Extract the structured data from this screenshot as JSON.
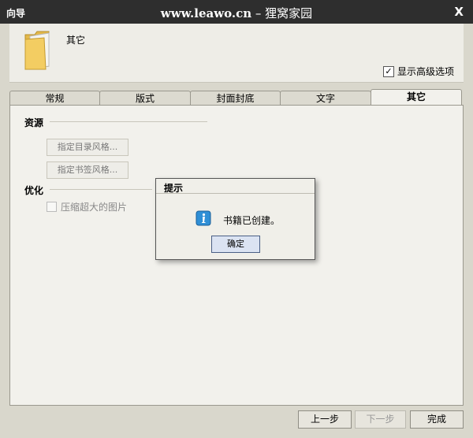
{
  "window": {
    "app_label": "向导",
    "site": "www.leawo.cn",
    "separator": " – ",
    "site_name": "狸窝家园",
    "close_glyph": "X"
  },
  "header": {
    "title": "其它",
    "advanced_label": "显示高级选项",
    "advanced_checked": true
  },
  "tabs": [
    {
      "label": "常规",
      "active": false
    },
    {
      "label": "版式",
      "active": false
    },
    {
      "label": "封面封底",
      "active": false
    },
    {
      "label": "文字",
      "active": false
    },
    {
      "label": "其它",
      "active": true
    }
  ],
  "content": {
    "resources_label": "资源",
    "toc_style_button": "指定目录风格...",
    "bookmark_style_button": "指定书签风格...",
    "optimize_label": "优化",
    "compress_label": "压缩超大的图片"
  },
  "dialog": {
    "title": "提示",
    "message": "书籍已创建。",
    "ok_button": "确定"
  },
  "footer": {
    "prev_button": "上一步",
    "next_button": "下一步",
    "finish_button": "完成"
  },
  "icons": {
    "folder": "folder-icon",
    "info": "info-icon",
    "check": "check-icon"
  }
}
